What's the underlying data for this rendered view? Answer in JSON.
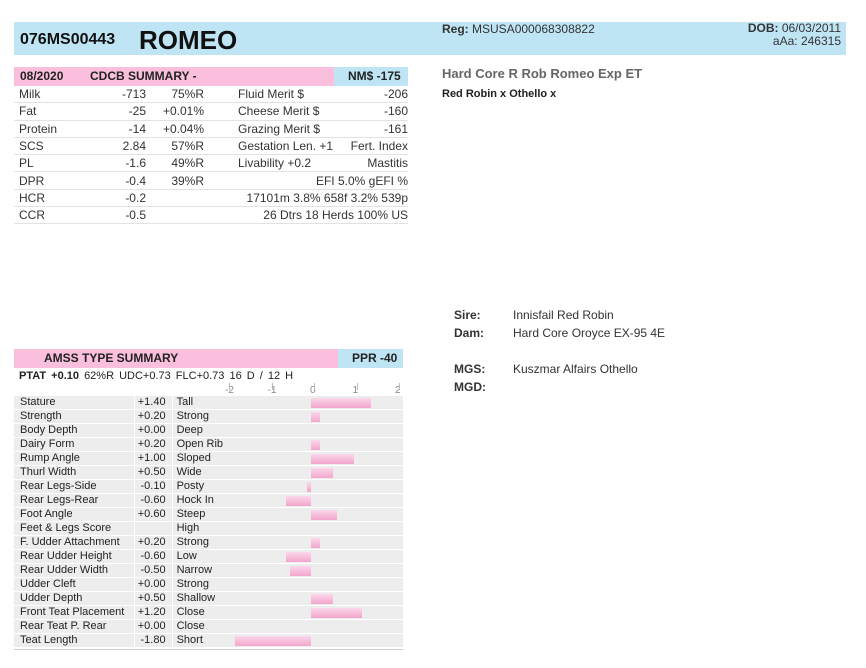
{
  "header": {
    "code": "076MS00443",
    "name": "ROMEO",
    "reg_label": "Reg:",
    "reg_value": "MSUSA000068308822",
    "dob_label": "DOB:",
    "dob_value": "06/03/2011",
    "aaa_label": "aAa:",
    "aaa_value": "246315"
  },
  "full_name": "Hard Core R Rob Romeo Exp ET",
  "parents_line": "Red Robin x Othello x",
  "cdcb": {
    "date": "08/2020",
    "title": "CDCB SUMMARY -",
    "nm": "NM$ -175",
    "rows": [
      {
        "trait": "Milk",
        "val": "-713",
        "rel": "75%R",
        "trait2": "Fluid Merit $",
        "val2": "-206"
      },
      {
        "trait": "Fat",
        "val": "-25",
        "rel": "+0.01%",
        "trait2": "Cheese Merit $",
        "val2": "-160"
      },
      {
        "trait": "Protein",
        "val": "-14",
        "rel": "+0.04%",
        "trait2": "Grazing Merit $",
        "val2": "-161"
      },
      {
        "trait": "SCS",
        "val": "2.84",
        "rel": "57%R",
        "trait2": "Gestation Len. +1",
        "val2": "Fert. Index"
      },
      {
        "trait": "PL",
        "val": "-1.6",
        "rel": "49%R",
        "trait2": "Livability  +0.2",
        "val2": "Mastitis"
      },
      {
        "trait": "DPR",
        "val": "-0.4",
        "rel": "39%R",
        "trait2": "EFI  5.0%   gEFI  %",
        "val2": ""
      },
      {
        "trait": "HCR",
        "val": "-0.2",
        "rel": "",
        "trait2": "17101m  3.8%  658f  3.2%  539p",
        "val2": ""
      },
      {
        "trait": "CCR",
        "val": "-0.5",
        "rel": "",
        "trait2": "26 Dtrs  18 Herds  100% US",
        "val2": ""
      }
    ]
  },
  "pedigree": {
    "sire_label": "Sire:",
    "sire": "Innisfail Red Robin",
    "dam_label": "Dam:",
    "dam": "Hard Core Oroyce EX-95 4E",
    "mgs_label": "MGS:",
    "mgs": "Kuszmar Alfairs Othello",
    "mgd_label": "MGD:",
    "mgd": ""
  },
  "type_summary": {
    "title": "AMSS TYPE SUMMARY",
    "ppr": "PPR -40",
    "ptat_label": "PTAT",
    "ptat_value": "+0.10",
    "ptat_rest": "62%R  UDC+0.73  FLC+0.73   16 D /  12 H",
    "scale_labels": [
      "-2",
      "-1",
      "0",
      "1",
      "2"
    ],
    "colors": {
      "pink_bar": "#f9bfdc",
      "blue_bar": "#bfe5f5",
      "row_bg": "#ededed"
    },
    "traits": [
      {
        "name": "Stature",
        "value": "+1.40",
        "desc": "Tall",
        "v": 1.4
      },
      {
        "name": "Strength",
        "value": "+0.20",
        "desc": "Strong",
        "v": 0.2
      },
      {
        "name": "Body Depth",
        "value": "+0.00",
        "desc": "Deep",
        "v": 0.0
      },
      {
        "name": "Dairy Form",
        "value": "+0.20",
        "desc": "Open Rib",
        "v": 0.2
      },
      {
        "name": "Rump Angle",
        "value": "+1.00",
        "desc": "Sloped",
        "v": 1.0
      },
      {
        "name": "Thurl Width",
        "value": "+0.50",
        "desc": "Wide",
        "v": 0.5
      },
      {
        "name": "Rear Legs-Side",
        "value": "-0.10",
        "desc": "Posty",
        "v": -0.1
      },
      {
        "name": "Rear Legs-Rear",
        "value": "-0.60",
        "desc": "Hock In",
        "v": -0.6
      },
      {
        "name": "Foot Angle",
        "value": "+0.60",
        "desc": "Steep",
        "v": 0.6
      },
      {
        "name": "Feet & Legs Score",
        "value": "",
        "desc": "High",
        "v": 0
      },
      {
        "name": "F. Udder Attachment",
        "value": "+0.20",
        "desc": "Strong",
        "v": 0.2
      },
      {
        "name": "Rear Udder Height",
        "value": "-0.60",
        "desc": "Low",
        "v": -0.6
      },
      {
        "name": "Rear Udder Width",
        "value": "-0.50",
        "desc": "Narrow",
        "v": -0.5
      },
      {
        "name": "Udder Cleft",
        "value": "+0.00",
        "desc": "Strong",
        "v": 0.0
      },
      {
        "name": "Udder Depth",
        "value": "+0.50",
        "desc": "Shallow",
        "v": 0.5
      },
      {
        "name": "Front Teat Placement",
        "value": "+1.20",
        "desc": "Close",
        "v": 1.2
      },
      {
        "name": "Rear Teat P. Rear",
        "value": "+0.00",
        "desc": "Close",
        "v": 0.0
      },
      {
        "name": "Teat Length",
        "value": "-1.80",
        "desc": "Short",
        "v": -1.8
      }
    ]
  }
}
